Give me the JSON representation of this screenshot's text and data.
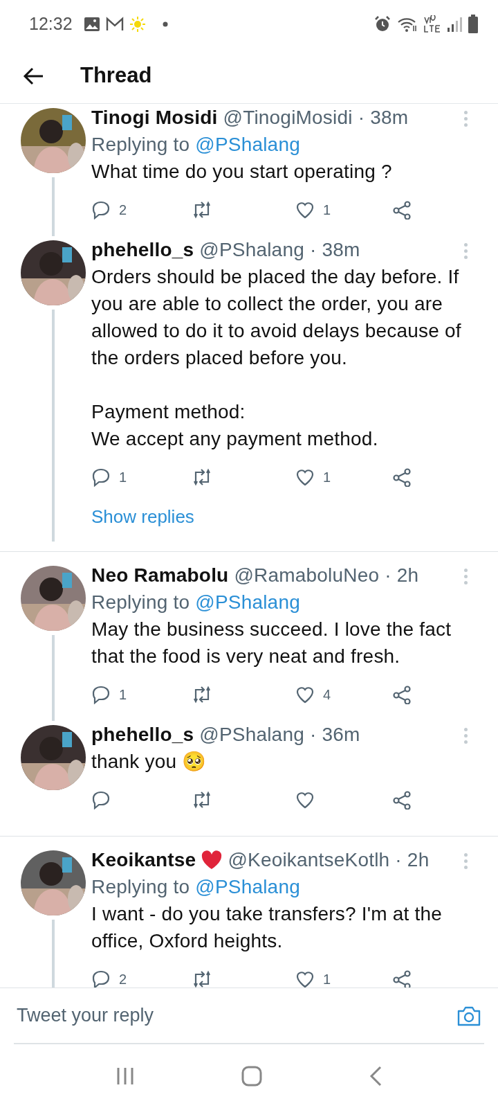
{
  "status_bar": {
    "time": "12:32"
  },
  "header": {
    "title": "Thread"
  },
  "tweets": [
    {
      "name": "Tinogi Mosidi",
      "handle": "@TinogiMosidi · 38m",
      "replying_label": "Replying to",
      "replying_to": "@PShalang",
      "text": [
        "What time do you start operating ?"
      ],
      "replies": "2",
      "likes": "1",
      "connected": true,
      "divider_after": false
    },
    {
      "name": "phehello_s",
      "handle": "@PShalang · 38m",
      "text": [
        "Orders should be placed the day before. If you are able to collect the order, you are allowed to do it to avoid delays because of the orders placed before you.",
        "Payment method:\nWe accept any payment method."
      ],
      "replies": "1",
      "likes": "1",
      "connected": true,
      "show_replies": "Show replies",
      "divider_after": true
    },
    {
      "name": "Neo Ramabolu",
      "handle": "@RamaboluNeo · 2h",
      "replying_label": "Replying to",
      "replying_to": "@PShalang",
      "text": [
        "May the business succeed. I love the fact that the food is very neat and fresh."
      ],
      "replies": "1",
      "likes": "4",
      "connected": true,
      "divider_after": false
    },
    {
      "name": "phehello_s",
      "handle": "@PShalang · 36m",
      "text": [
        "thank you 🥺"
      ],
      "connected": false,
      "divider_after": true
    },
    {
      "name": "Keoikantse",
      "heart": true,
      "handle": "@KeoikantseKotlh · 2h",
      "replying_label": "Replying to",
      "replying_to": "@PShalang",
      "text": [
        "I want - do you take transfers? I'm at the office, Oxford heights."
      ],
      "replies": "2",
      "likes": "1",
      "connected": true,
      "divider_after": false
    }
  ],
  "reply_box": {
    "placeholder": "Tweet your reply"
  }
}
